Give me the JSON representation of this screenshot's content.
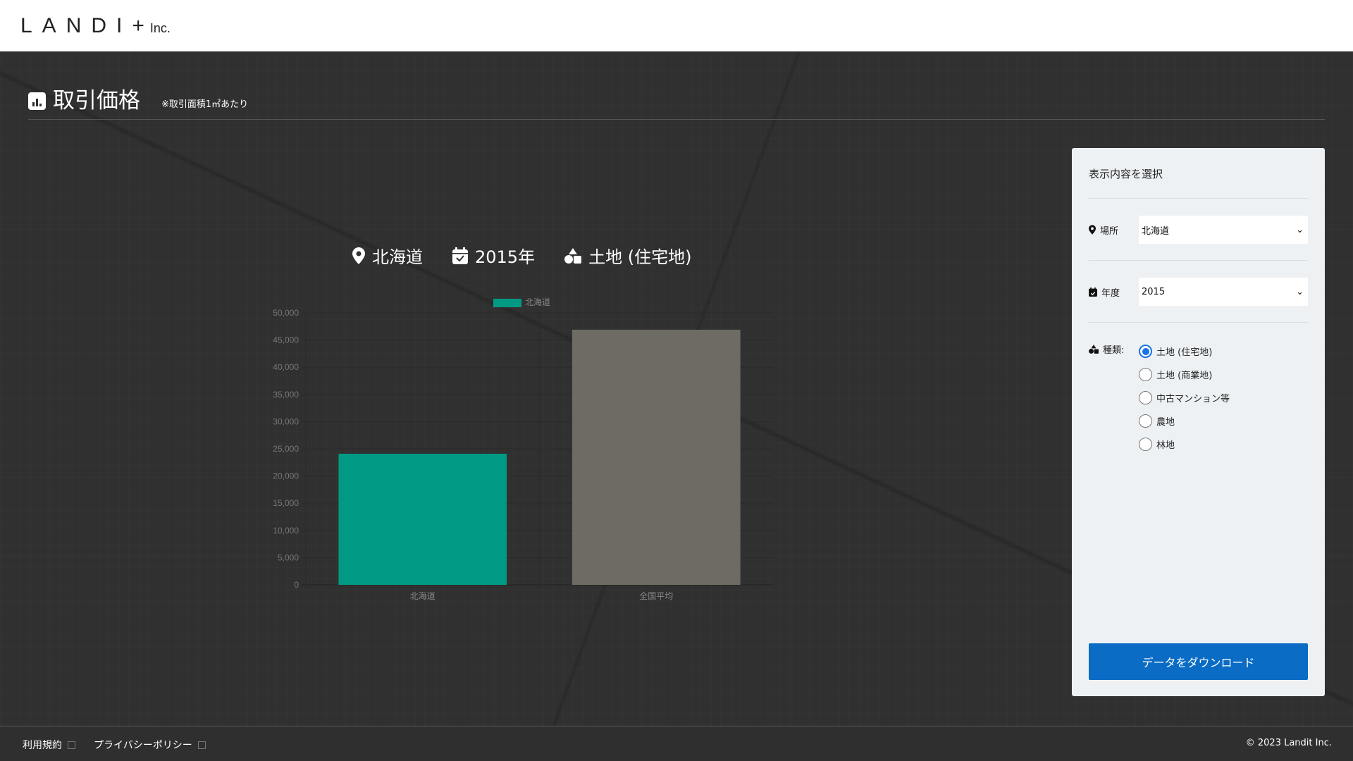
{
  "header": {
    "logo": "LANDI+",
    "logo_suffix": "Inc."
  },
  "page": {
    "title": "取引価格",
    "note": "※取引面積1㎡あたり"
  },
  "chart_header": {
    "location": "北海道",
    "year": "2015年",
    "type": "土地 (住宅地)"
  },
  "chart_data": {
    "type": "bar",
    "categories": [
      "北海道",
      "全国平均"
    ],
    "values": [
      24100,
      46900
    ],
    "colors": [
      "#009a84",
      "#6d6b62"
    ],
    "legend": [
      "北海道"
    ],
    "legend_placement": "top",
    "ylim": [
      0,
      50000
    ],
    "yticks": [
      "0",
      "5,000",
      "10,000",
      "15,000",
      "20,000",
      "25,000",
      "30,000",
      "35,000",
      "40,000",
      "45,000",
      "50,000"
    ],
    "grid": true
  },
  "panel": {
    "title": "表示内容を選択",
    "location_label": "場所",
    "location_value": "北海道",
    "year_label": "年度",
    "year_value": "2015",
    "type_label": "種類:",
    "types": [
      {
        "label": "土地 (住宅地)",
        "checked": true
      },
      {
        "label": "土地 (商業地)"
      },
      {
        "label": "中古マンション等"
      },
      {
        "label": "農地"
      },
      {
        "label": "林地"
      }
    ],
    "download": "データをダウンロード"
  },
  "footer": {
    "terms": "利用規約",
    "privacy": "プライバシーポリシー",
    "copyright": "© 2023 Landit Inc."
  }
}
